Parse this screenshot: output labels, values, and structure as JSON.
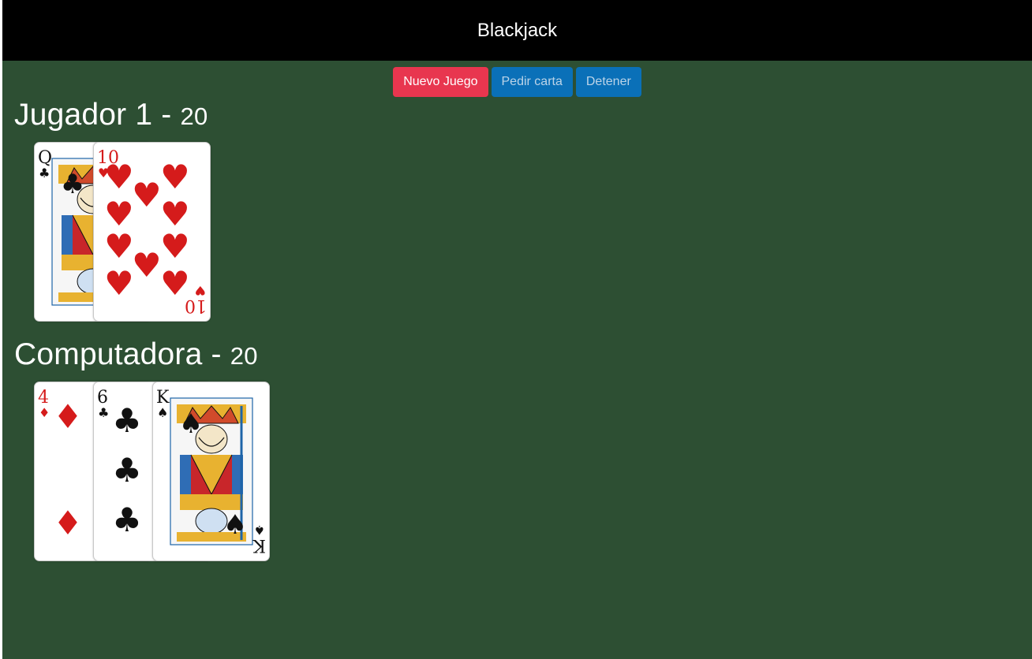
{
  "header": {
    "title": "Blackjack"
  },
  "controls": {
    "new_game": "Nuevo Juego",
    "hit": "Pedir carta",
    "stand": "Detener"
  },
  "players": [
    {
      "name": "Jugador 1",
      "separator": " - ",
      "score": "20",
      "cards": [
        {
          "rank": "Q",
          "suit": "clubs"
        },
        {
          "rank": "10",
          "suit": "hearts"
        }
      ]
    },
    {
      "name": "Computadora",
      "separator": " - ",
      "score": "20",
      "cards": [
        {
          "rank": "4",
          "suit": "diamonds"
        },
        {
          "rank": "6",
          "suit": "clubs"
        },
        {
          "rank": "K",
          "suit": "spades"
        }
      ]
    }
  ],
  "colors": {
    "table": "#2d4f33",
    "navbar": "#000000",
    "new_game_button": "#e8364f",
    "action_button": "#0a70b8",
    "red_suit": "#d51b1b",
    "black_suit": "#111111"
  }
}
